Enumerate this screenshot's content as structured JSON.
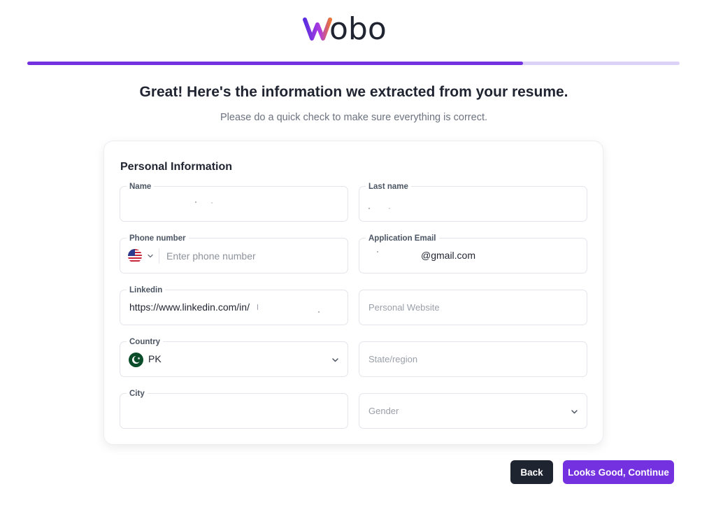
{
  "brand": {
    "logo_text": "wobo",
    "accent": "#7431e0",
    "logo_gradient": [
      "#5b2ee0",
      "#b03be0",
      "#e8743a"
    ]
  },
  "progress": {
    "value_percent": 76
  },
  "header": {
    "title": "Great! Here's the information we extracted from your resume.",
    "subtitle": "Please do a quick check to make sure everything is correct."
  },
  "card": {
    "title": "Personal Information",
    "fields": {
      "name": {
        "label": "Name",
        "value": ""
      },
      "last_name": {
        "label": "Last name",
        "value": ""
      },
      "phone": {
        "label": "Phone number",
        "placeholder": "Enter phone number",
        "country_flag": "us-flag-icon"
      },
      "email": {
        "label": "Application Email",
        "value": "@gmail.com"
      },
      "linkedin": {
        "label": "Linkedin",
        "value": "https://www.linkedin.com/in/"
      },
      "website": {
        "placeholder": "Personal Website"
      },
      "country": {
        "label": "Country",
        "value": "PK",
        "flag": "pk-flag-icon"
      },
      "state": {
        "placeholder": "State/region"
      },
      "city": {
        "label": "City",
        "value": ""
      },
      "gender": {
        "placeholder": "Gender"
      }
    }
  },
  "actions": {
    "back_label": "Back",
    "continue_label": "Looks Good, Continue"
  }
}
